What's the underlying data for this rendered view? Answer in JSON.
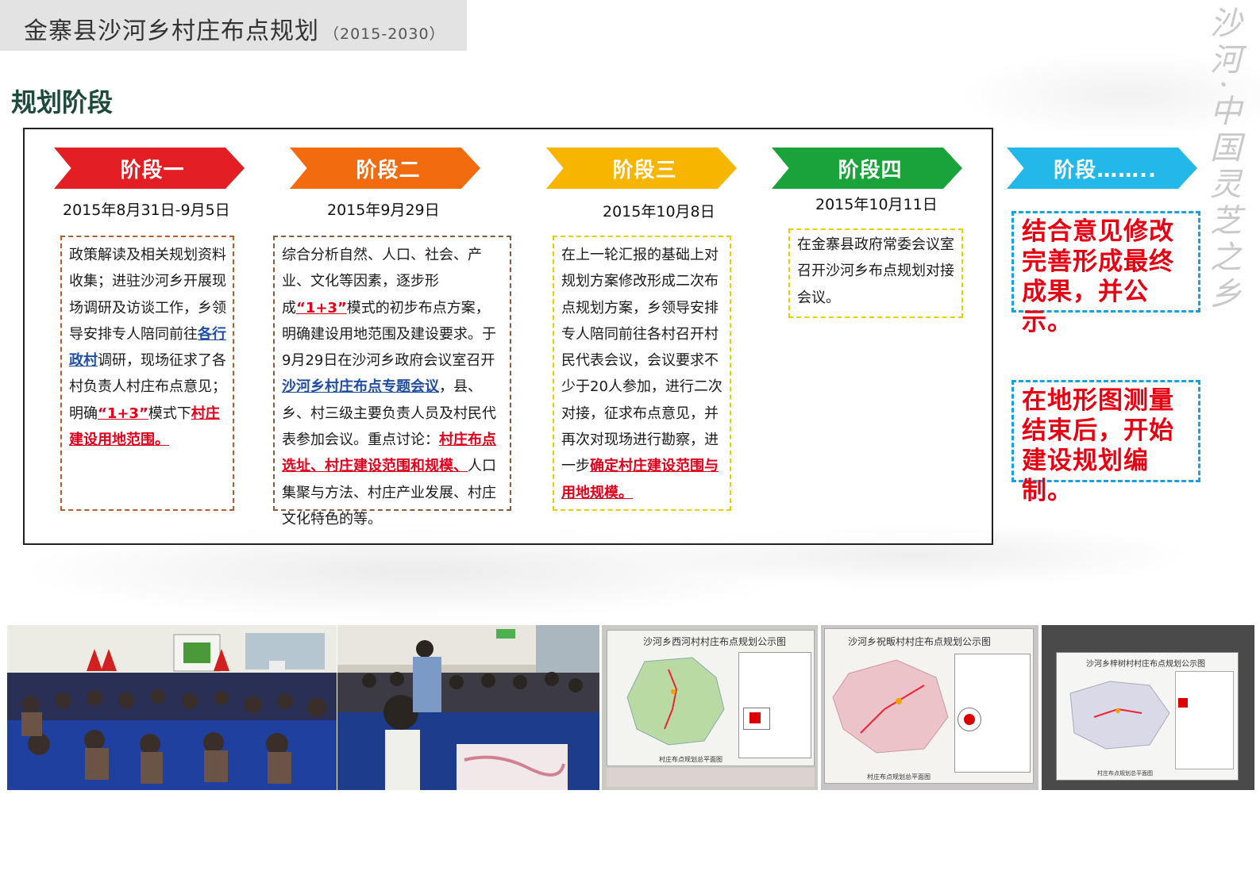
{
  "header": {
    "title": "金寨县沙河乡村庄布点规划",
    "years": "（2015-2030）"
  },
  "slogan": "沙河·中国灵芝之乡",
  "section_title": "规划阶段",
  "stages": [
    {
      "label": "阶段一",
      "color": "#e31e24",
      "date": "2015年8月31日-9月5日",
      "border_color": "#b35c2e",
      "segments": [
        {
          "t": "政策解读及相关规划资料收集；进驻沙河乡开展现场调研及访谈工作，乡领导安排专人陪同前往",
          "s": ""
        },
        {
          "t": "各行政村",
          "s": "blue"
        },
        {
          "t": "调研，现场征求了各村负责人村庄布点意见；",
          "s": ""
        },
        {
          "t": "明确",
          "s": ""
        },
        {
          "t": "“1+3”",
          "s": "red"
        },
        {
          "t": "模式下",
          "s": ""
        },
        {
          "t": "村庄建设用地范围。",
          "s": "red"
        }
      ]
    },
    {
      "label": "阶段二",
      "color": "#f26b0f",
      "date": "2015年9月29日",
      "border_color": "#8a5a3a",
      "segments": [
        {
          "t": "综合分析自然、人口、社会、产业、文化等因素，逐步形成",
          "s": ""
        },
        {
          "t": "“1+3”",
          "s": "red"
        },
        {
          "t": "模式的初步布点方案，明确建设用地范围及建设要求。于9月29日在沙河乡政府会议室召开",
          "s": ""
        },
        {
          "t": "沙河乡村庄布点专题会议",
          "s": "blue"
        },
        {
          "t": "，县、乡、村三级主要负责人员及村民代表参加会议。重点讨论：",
          "s": ""
        },
        {
          "t": "村庄布点选址、村庄建设范围和规模、",
          "s": "red"
        },
        {
          "t": "人口集聚与方法、村庄产业发展、村庄文化特色的等。",
          "s": ""
        }
      ]
    },
    {
      "label": "阶段三",
      "color": "#f7b500",
      "date": "2015年10月8日",
      "border_color": "#e8d000",
      "segments": [
        {
          "t": "在上一轮汇报的基础上对规划方案修改形成二次布点规划方案，乡领导安排专人陪同前往各村召开村民代表会议，会议要求不少于20人参加，进行二次对接，征求布点意见，并再次对现场进行勘察，进一步",
          "s": ""
        },
        {
          "t": "确定村庄建设范围与用地规模。",
          "s": "red"
        }
      ]
    },
    {
      "label": "阶段四",
      "color": "#1aa33a",
      "date": "2015年10月11日",
      "border_color": "#e8d000",
      "segments": [
        {
          "t": "在金寨县政府常委会议室召开沙河乡布点规划对接会议。",
          "s": ""
        }
      ]
    },
    {
      "label": "阶段……..",
      "color": "#23b8e8",
      "date": "",
      "border_color": "",
      "segments": []
    }
  ],
  "notes": [
    "结合意见修改完善形成最终成果，并公示。",
    "在地形图测量结束后，开始建设规划编制。"
  ],
  "photos": [
    {
      "kind": "meeting-hall",
      "caption": "",
      "map_title": ""
    },
    {
      "kind": "meeting-room",
      "caption": "",
      "map_title": ""
    },
    {
      "kind": "map-board",
      "map_title": "沙河乡西河村村庄布点规划公示图",
      "caption": "村庄布点规划总平面图"
    },
    {
      "kind": "map-board",
      "map_title": "沙河乡祝畈村村庄布点规划公示图",
      "caption": "村庄布点规划总平面图"
    },
    {
      "kind": "map-board",
      "map_title": "沙河乡梓树村村庄布点规划公示图",
      "caption": "村庄布点规划总平面图"
    }
  ]
}
